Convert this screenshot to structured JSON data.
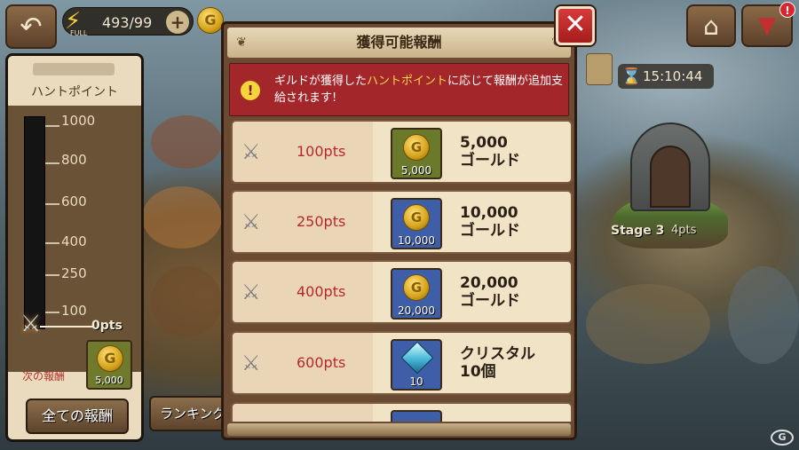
{
  "top_bar": {
    "stamina_value": "493/99",
    "stamina_status": "FULL",
    "plus_symbol": "+",
    "coin_symbol": "G"
  },
  "timer": {
    "value": "15:10:44"
  },
  "stage": {
    "label": "Stage 3",
    "points": "4pts"
  },
  "hunt_panel": {
    "title": "ハントポイント",
    "scale": [
      "1000",
      "800",
      "600",
      "400",
      "250",
      "100"
    ],
    "current": "0pts",
    "next_reward_label": "次の報酬",
    "next_reward_amount": "5,000",
    "all_rewards_button": "全ての報酬",
    "ranking_button": "ランキング"
  },
  "modal": {
    "title": "獲得可能報酬",
    "close_symbol": "✕",
    "notice": {
      "icon": "!",
      "text_before": "ギルドが獲得した",
      "highlight": "ハントポイント",
      "text_after": "に応じて報酬が追加支給されます!"
    },
    "rewards": [
      {
        "points": "100pts",
        "item_amount": "5,000",
        "name": "5,000\nゴールド",
        "icon": "gold-coin-icon",
        "box_color": "green"
      },
      {
        "points": "250pts",
        "item_amount": "10,000",
        "name": "10,000\nゴールド",
        "icon": "gold-coin-icon",
        "box_color": "blue"
      },
      {
        "points": "400pts",
        "item_amount": "20,000",
        "name": "20,000\nゴールド",
        "icon": "gold-coin-icon",
        "box_color": "blue"
      },
      {
        "points": "600pts",
        "item_amount": "10",
        "name": "クリスタル\n10個",
        "icon": "crystal-icon",
        "box_color": "blue"
      }
    ]
  },
  "colors": {
    "notice_bg": "#a3262a",
    "points_text": "#b7282a",
    "highlight_text": "#ffd84a",
    "close_button": "#d83a3a"
  }
}
